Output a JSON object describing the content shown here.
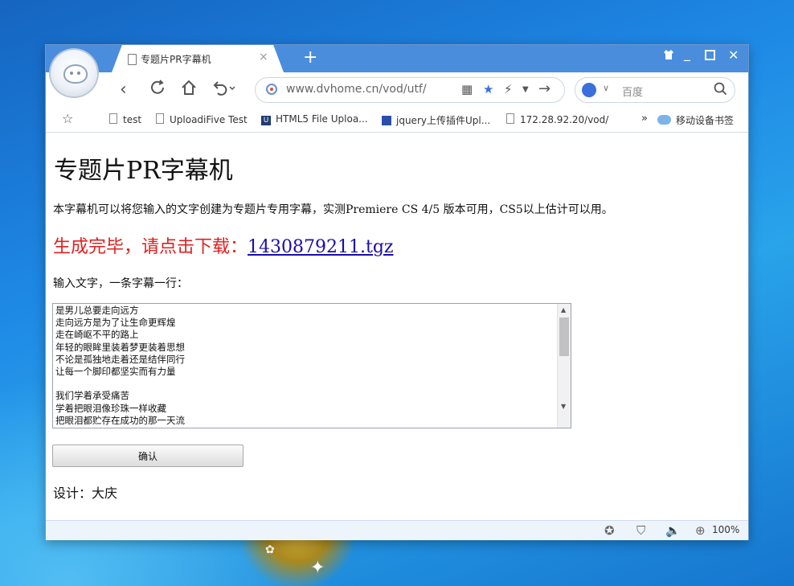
{
  "browser": {
    "tab_title": "专题片PR字幕机",
    "tab_close": "×",
    "new_tab": "+",
    "url": "www.dvhome.cn/vod/utf/",
    "search_placeholder": "百度",
    "zoom": "100%",
    "bookmarks": [
      "test",
      "UploadiFive Test",
      "HTML5 File Uploa...",
      "jquery上传插件Upl...",
      "172.28.92.20/vod/"
    ],
    "bookmarks_more": "»",
    "mobile_bookmarks": "移动设备书签",
    "icons": {
      "back": "back-icon",
      "refresh": "refresh-icon",
      "home": "home-icon",
      "undo": "undo-icon",
      "qr": "qr-code-icon",
      "star": "star-icon",
      "bolt": "lightning-icon",
      "forward": "forward-icon",
      "search": "search-icon"
    },
    "accent_color": "#4a8ddc"
  },
  "page": {
    "title": "专题片PR字幕机",
    "description": "本字幕机可以将您输入的文字创建为专题片专用字幕，实测Premiere CS 4/5 版本可用，CS5以上估计可以用。",
    "success_prefix": "生成完毕，请点击下载：",
    "download_link": "1430879211.tgz",
    "input_label": "输入文字，一条字幕一行：",
    "textarea_value": "是男儿总要走向远方\n走向远方是为了让生命更辉煌\n走在崎岖不平的路上\n年轻的眼眸里装着梦更装着思想\n不论是孤独地走着还是结伴同行\n让每一个脚印都坚实而有力量\n\n我们学着承受痛苦\n学着把眼泪像珍珠一样收藏\n把眼泪都贮存在成功的那一天流",
    "submit_label": "确认",
    "footer": "设计：大庆",
    "success_color": "#e02020"
  }
}
